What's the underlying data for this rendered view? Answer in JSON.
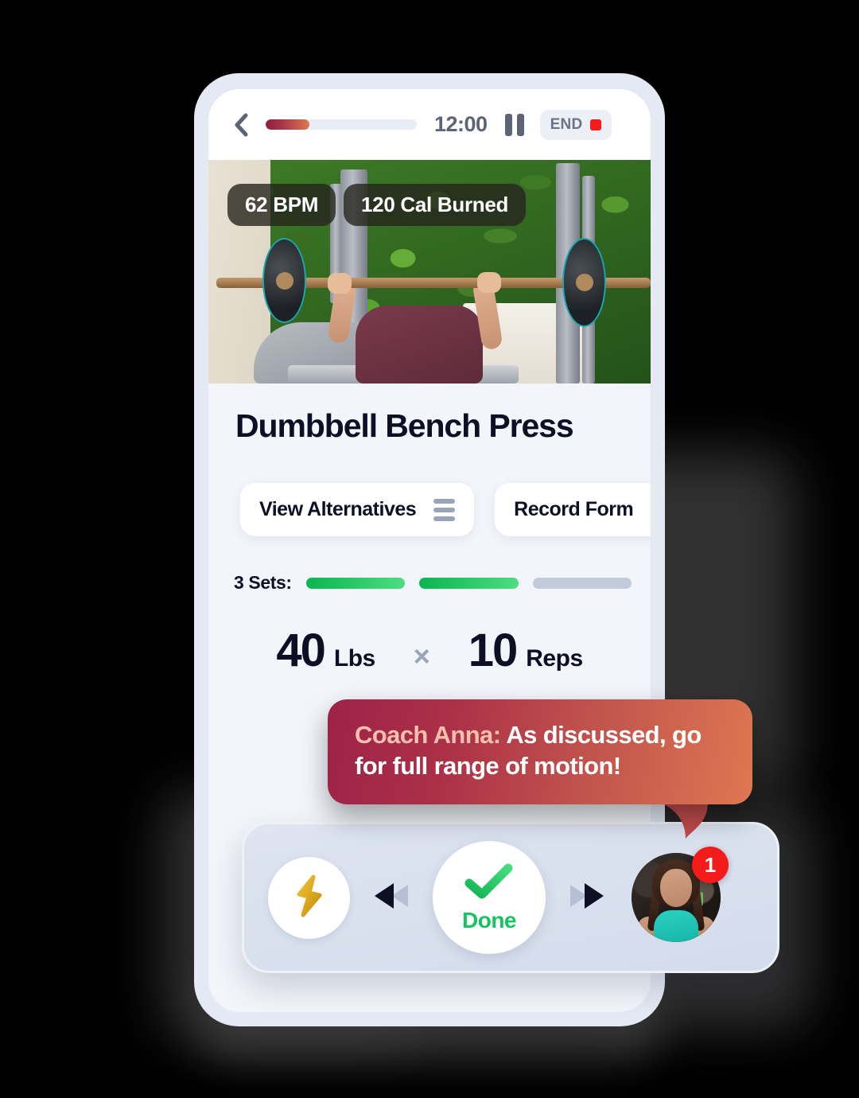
{
  "topbar": {
    "back_icon": "chevron-left-icon",
    "timer": "12:00",
    "timer_progress_percent": 29,
    "pause_icon": "pause-icon",
    "end_label": "END",
    "end_dot_color": "#f41b1b",
    "progress_gradient_from": "#8e1f3f",
    "progress_gradient_to": "#e07a4f"
  },
  "hero": {
    "stats": [
      {
        "label": "62 BPM",
        "name": "heart-rate-badge"
      },
      {
        "label": "120 Cal Burned",
        "name": "calories-badge"
      }
    ]
  },
  "exercise": {
    "title": "Dumbbell Bench Press"
  },
  "chips": [
    {
      "label": "View Alternatives",
      "icon": "list-icon"
    },
    {
      "label": "Record Form",
      "icon": "video-camera-icon"
    }
  ],
  "sets": {
    "label": "3 Sets:",
    "total": 3,
    "completed": 2,
    "done_color": "#0ab54f",
    "pending_color": "#c3cbdb"
  },
  "metrics": {
    "weight_value": "40",
    "weight_unit": "Lbs",
    "separator": "×",
    "reps_value": "10",
    "reps_unit": "Reps"
  },
  "coach": {
    "name": "Coach Anna:",
    "message": "As discussed, go for full range of motion!",
    "gradient_from": "#9e2248",
    "gradient_to": "#de7751",
    "name_color": "#f6bfae"
  },
  "actionbar": {
    "boost_icon": "lightning-bolt-icon",
    "prev_icon": "skip-previous-icon",
    "next_icon": "skip-next-icon",
    "done_label": "Done",
    "done_icon": "check-icon",
    "done_color": "#17c462",
    "avatar_name": "coach-avatar",
    "notification_count": "1",
    "notification_color": "#f41b1b"
  }
}
